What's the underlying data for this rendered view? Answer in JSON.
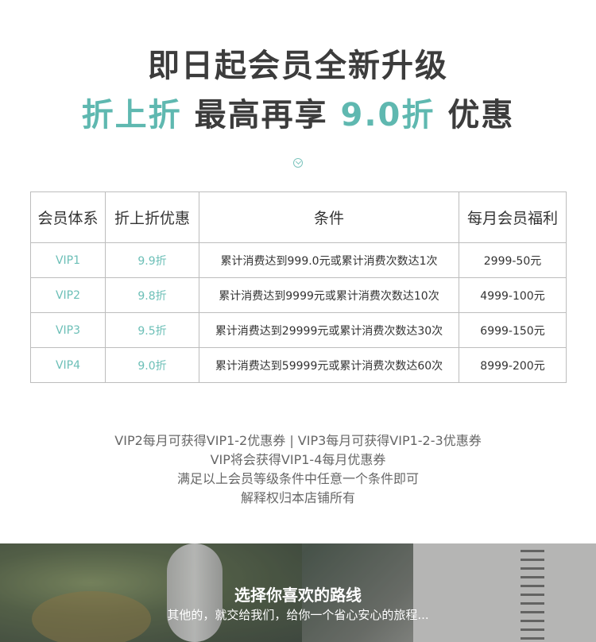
{
  "headline": {
    "line1": "即日起会员全新升级",
    "line2_part1": "折上折",
    "line2_part2": " 最高再享 ",
    "line2_part3": "9.0折",
    "line2_part4": " 优惠"
  },
  "table": {
    "headers": [
      "会员体系",
      "折上折优惠",
      "条件",
      "每月会员福利"
    ],
    "rows": [
      [
        "VIP1",
        "9.9折",
        "累计消费达到999.0元或累计消费次数达1次",
        "2999-50元"
      ],
      [
        "VIP2",
        "9.8折",
        "累计消费达到9999元或累计消费次数达10次",
        "4999-100元"
      ],
      [
        "VIP3",
        "9.5折",
        "累计消费达到29999元或累计消费次数达30次",
        "6999-150元"
      ],
      [
        "VIP4",
        "9.0折",
        "累计消费达到59999元或累计消费次数达60次",
        "8999-200元"
      ]
    ]
  },
  "notes": [
    "VIP2每月可获得VIP1-2优惠券 | VIP3每月可获得VIP1-2-3优惠券",
    "VIP将会获得VIP1-4每月优惠券",
    "满足以上会员等级条件中任意一个条件即可",
    "解释权归本店铺所有"
  ],
  "banner": {
    "title": "选择你喜欢的路线",
    "subtitle": "其他的，就交给我们，给你一个省心安心的旅程..."
  },
  "colors": {
    "accent": "#5fb8b0",
    "text": "#3c3c3c"
  }
}
